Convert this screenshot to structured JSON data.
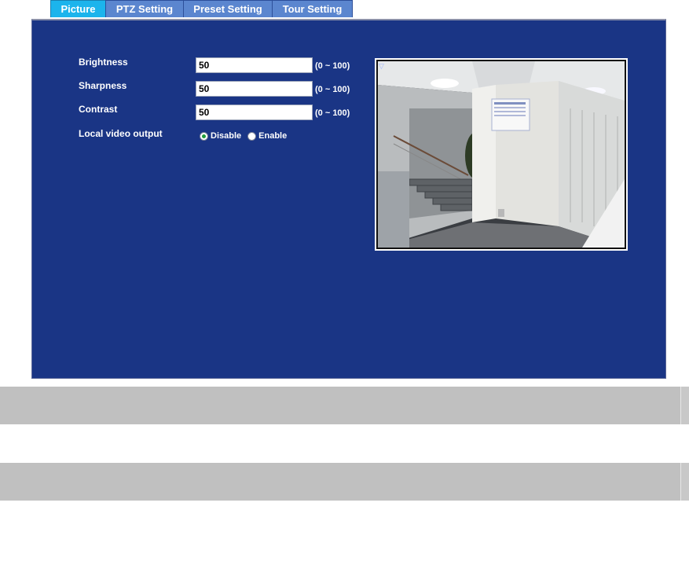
{
  "tabs": [
    {
      "label": "Picture",
      "active": true
    },
    {
      "label": "PTZ Setting",
      "active": false
    },
    {
      "label": "Preset Setting",
      "active": false
    },
    {
      "label": "Tour Setting",
      "active": false
    }
  ],
  "settings": {
    "brightness": {
      "label": "Brightness",
      "value": "50",
      "range": "(0 ~ 100)"
    },
    "sharpness": {
      "label": "Sharpness",
      "value": "50",
      "range": "(0 ~ 100)"
    },
    "contrast": {
      "label": "Contrast",
      "value": "50",
      "range": "(0 ~ 100)"
    },
    "local_video_output": {
      "label": "Local video output",
      "options": [
        "Disable",
        "Enable"
      ],
      "selected": "Disable"
    }
  },
  "colors": {
    "panel_bg": "#1a3585",
    "tab_active": "#1cb4ec",
    "tab_inactive": "#5b86cf",
    "bar_gray": "#c0c0c0"
  },
  "icons": {
    "radio_selected": "radio-checked-icon",
    "radio_unselected": "radio-unchecked-icon"
  }
}
